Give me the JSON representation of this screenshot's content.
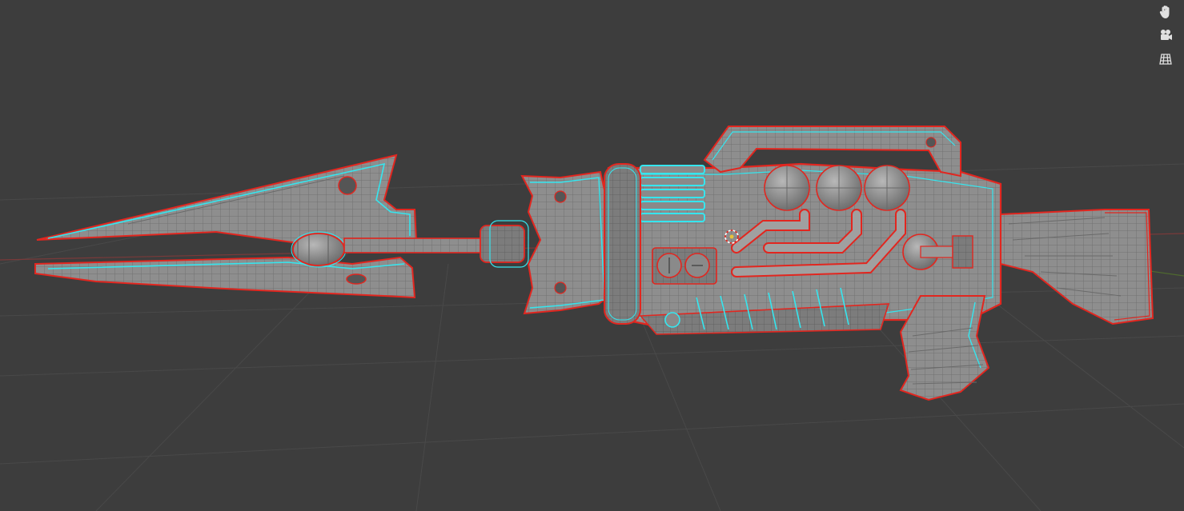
{
  "viewport": {
    "type": "3d-viewport",
    "background_color": "#3d3d3d",
    "grid_color": "#4a4a4a",
    "x_axis_color": "#7a3a3a",
    "y_axis_color": "#4f6a2f"
  },
  "model": {
    "name": "sci-fi-blaster-rifle",
    "shading": "solid",
    "base_color": "#8e8e8e",
    "wire_color": "#5e5e5e",
    "seam_color": "#e2261f",
    "sharp_edge_color": "#35e6ef"
  },
  "navigation_gizmo": {
    "buttons": [
      {
        "name": "hand-icon",
        "tooltip": ""
      },
      {
        "name": "camera-icon",
        "tooltip": ""
      },
      {
        "name": "grid-icon",
        "tooltip": ""
      }
    ]
  }
}
